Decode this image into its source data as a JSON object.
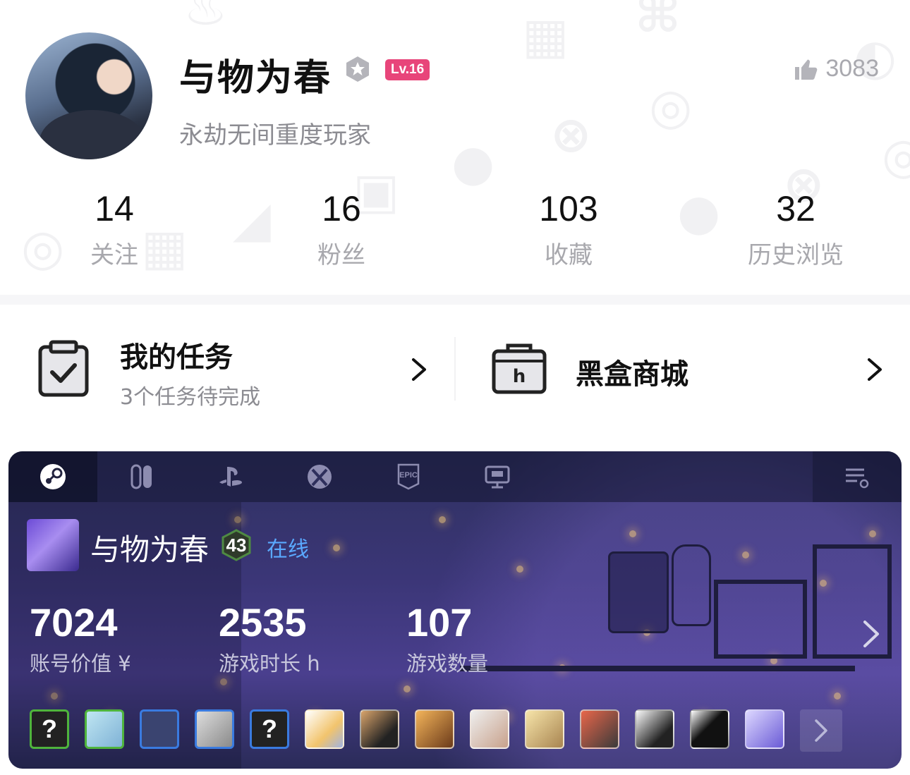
{
  "profile": {
    "username": "与物为春",
    "level_badge": "Lv.16",
    "bio": "永劫无间重度玩家",
    "likes": "3083"
  },
  "stats": [
    {
      "value": "14",
      "label": "关注"
    },
    {
      "value": "16",
      "label": "粉丝"
    },
    {
      "value": "103",
      "label": "收藏"
    },
    {
      "value": "32",
      "label": "历史浏览"
    }
  ],
  "tasks": {
    "title": "我的任务",
    "subtitle": "3个任务待完成"
  },
  "store": {
    "title": "黑盒商城"
  },
  "game_card": {
    "platform_tabs": [
      "steam-icon",
      "nintendo-switch-icon",
      "playstation-icon",
      "xbox-icon",
      "epic-games-icon",
      "pc-icon"
    ],
    "active_tab": "steam-icon",
    "steam_name": "与物为春",
    "steam_level": "43",
    "status": "在线",
    "stats": [
      {
        "value": "7024",
        "label": "账号价值 ¥"
      },
      {
        "value": "2535",
        "label": "游戏时长 h"
      },
      {
        "value": "107",
        "label": "游戏数量"
      }
    ],
    "colors": {
      "online": "#5aa9ff",
      "level_badge": "#e8457a"
    }
  }
}
